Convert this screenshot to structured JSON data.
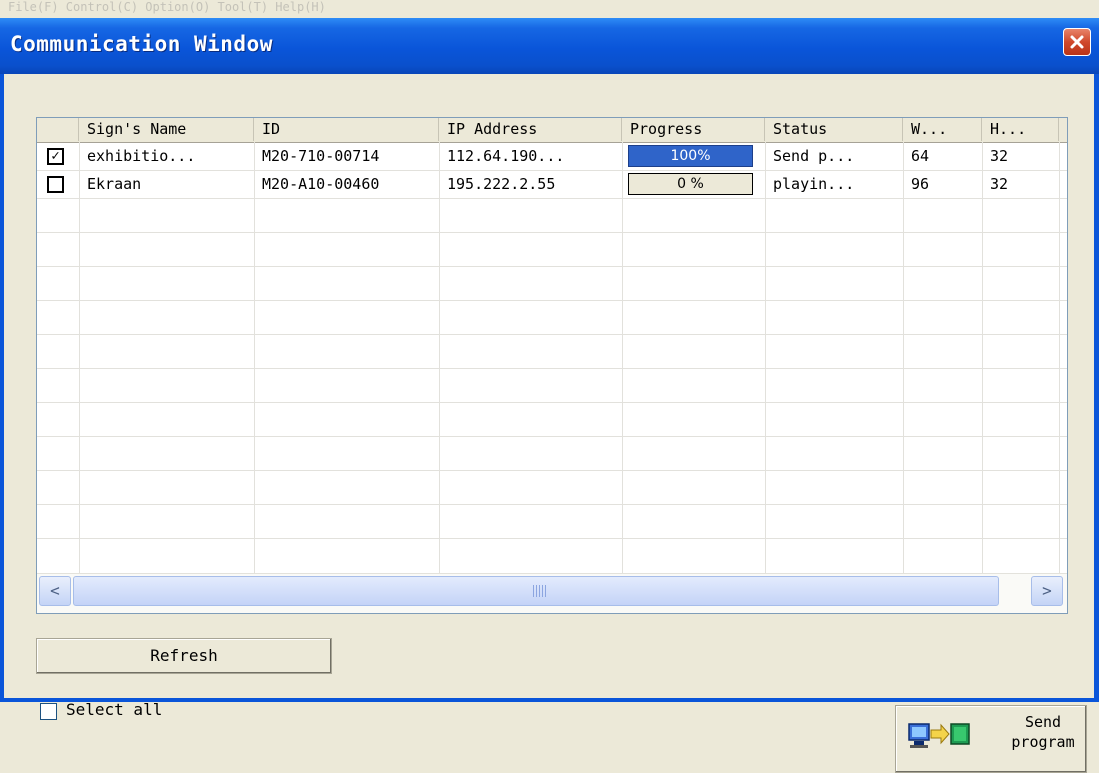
{
  "window": {
    "title": "Communication Window",
    "ghost_menu": "File(F)  Control(C)  Option(O)  Tool(T)  Help(H)"
  },
  "table": {
    "columns": [
      "",
      "Sign's Name",
      "ID",
      "IP Address",
      "Progress",
      "Status",
      "W...",
      "H..."
    ],
    "rows": [
      {
        "checked": true,
        "check_mark": "✓",
        "name": "exhibitio...",
        "id": "M20-710-00714",
        "ip": "112.64.190...",
        "progress_label": "100%",
        "progress": 100,
        "status": "Send p...",
        "w": "64",
        "h": "32"
      },
      {
        "checked": false,
        "check_mark": "",
        "name": "Ekraan",
        "id": "M20-A10-00460",
        "ip": "195.222.2.55",
        "progress_label": "0 %",
        "progress": 0,
        "status": "playin...",
        "w": "96",
        "h": "32"
      }
    ]
  },
  "scrollbar": {
    "left_arrow": "<",
    "right_arrow": ">"
  },
  "buttons": {
    "refresh": "Refresh",
    "send": "Send\nprogram"
  },
  "select_all": {
    "label": "Select all",
    "checked": false
  },
  "colors": {
    "title_bar": "#0a55d9",
    "progress_fill": "#2f64c9",
    "close_button": "#d0492c"
  },
  "icons": [
    "close-icon",
    "send-program-icon",
    "scroll-left-icon",
    "scroll-right-icon",
    "checkbox-icon"
  ]
}
